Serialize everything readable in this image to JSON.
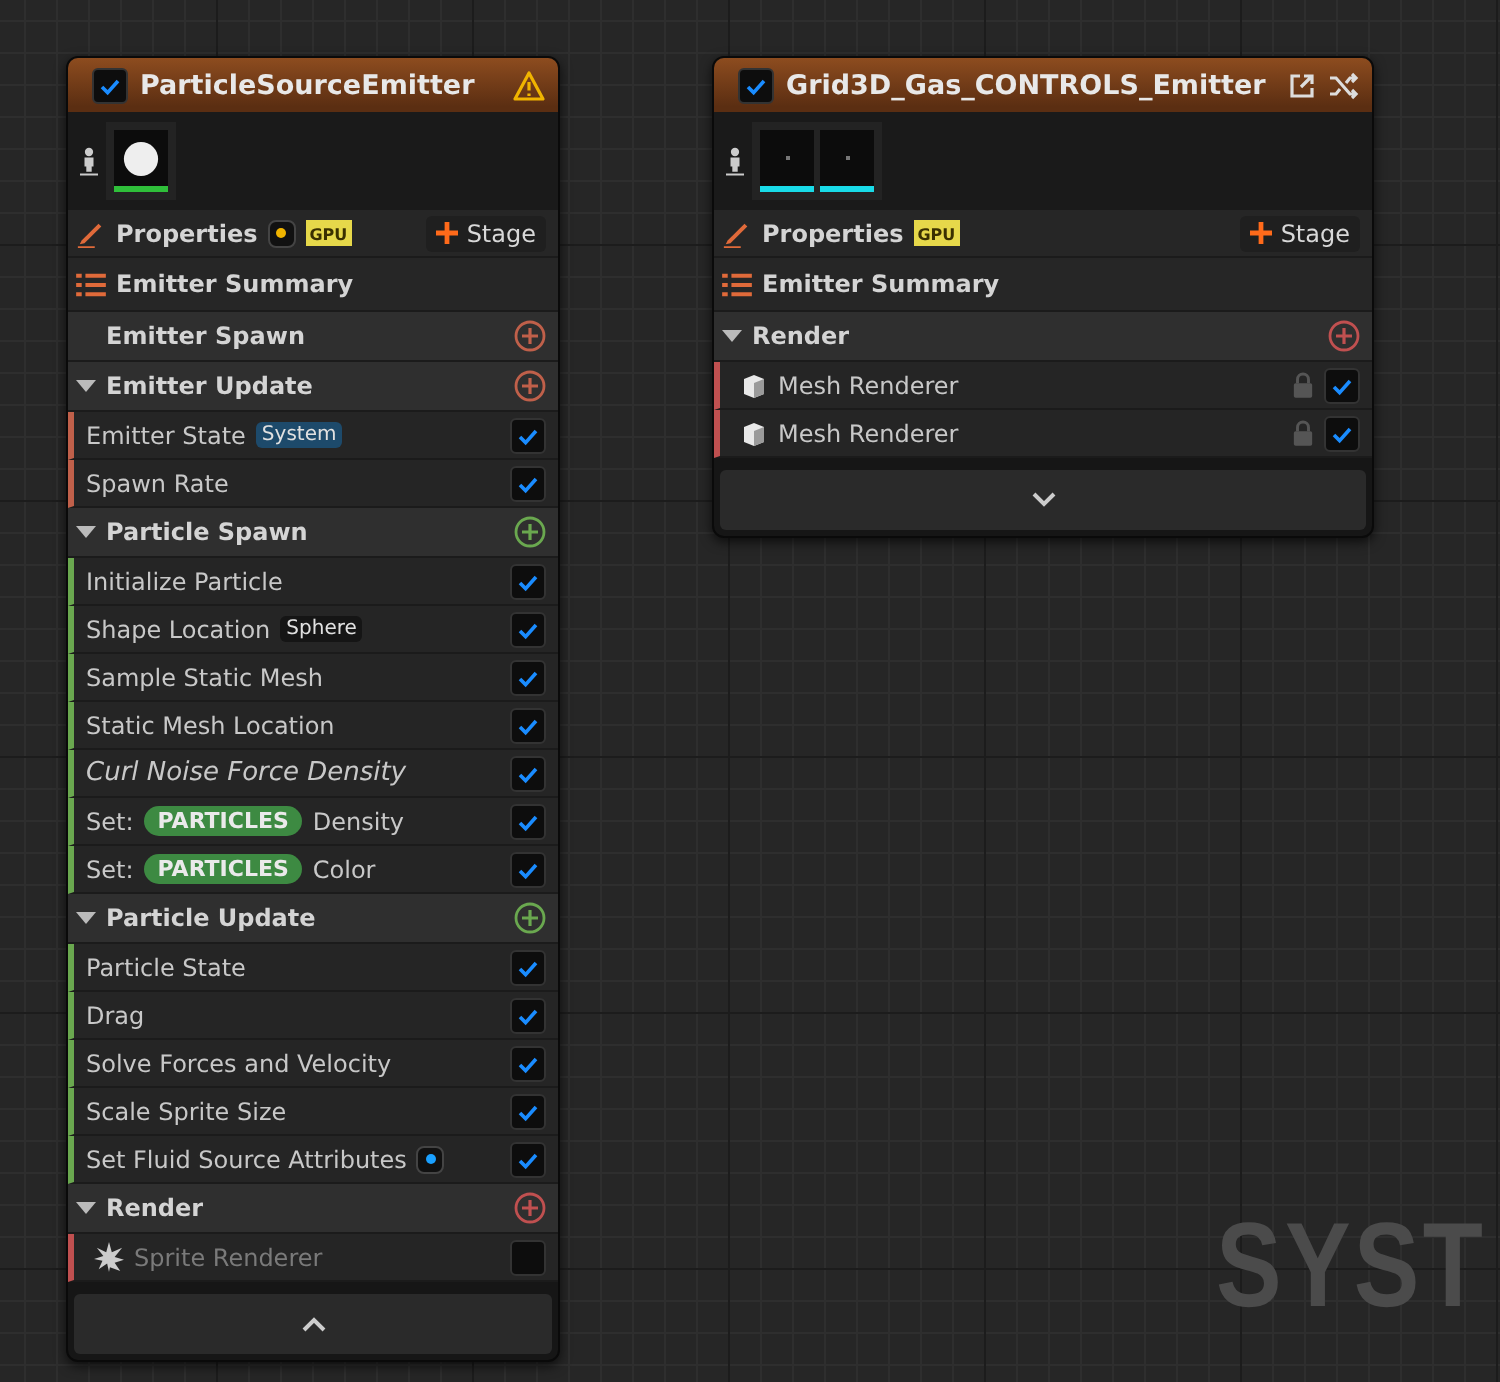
{
  "graph_label": "SYST",
  "emitters": [
    {
      "title": "ParticleSourceEmitter",
      "enabled": true,
      "header_icons": [
        {
          "kind": "warning"
        }
      ],
      "thumbnails": [
        {
          "kind": "sphere",
          "color": "#2fbf3a"
        }
      ],
      "properties": {
        "label": "Properties",
        "badges": [
          {
            "kind": "dot"
          },
          {
            "kind": "gpu",
            "text": "GPU"
          }
        ],
        "stage_button": "Stage"
      },
      "summary": "Emitter Summary",
      "sections": [
        {
          "title": "Emitter Spawn",
          "color": "#c0604a"
        },
        {
          "title": "Emitter Update",
          "color": "#c0604a",
          "modules": [
            {
              "kind": "module",
              "label": "Emitter State",
              "tag": {
                "text": "System",
                "color": "#1d4a6b"
              },
              "enabled": true
            },
            {
              "kind": "module",
              "label": "Spawn Rate",
              "enabled": true
            }
          ]
        },
        {
          "title": "Particle Spawn",
          "color": "#6aa84f",
          "modules": [
            {
              "kind": "module",
              "label": "Initialize Particle",
              "enabled": true
            },
            {
              "kind": "module",
              "label": "Shape Location",
              "tag": {
                "text": "Sphere",
                "color": "#151515"
              },
              "enabled": true
            },
            {
              "kind": "module",
              "label": "Sample Static Mesh",
              "enabled": true
            },
            {
              "kind": "module",
              "label": "Static Mesh Location",
              "enabled": true
            },
            {
              "kind": "dynamic_input",
              "label": "Curl Noise Force Density",
              "enabled": true
            },
            {
              "kind": "set",
              "prefix": "Set:",
              "pill": "PARTICLES",
              "label": "Density",
              "enabled": true
            },
            {
              "kind": "set",
              "prefix": "Set:",
              "pill": "PARTICLES",
              "label": "Color",
              "enabled": true
            }
          ]
        },
        {
          "title": "Particle Update",
          "color": "#6aa84f",
          "modules": [
            {
              "kind": "module",
              "label": "Particle State",
              "enabled": true
            },
            {
              "kind": "module",
              "label": "Drag",
              "enabled": true
            },
            {
              "kind": "module",
              "label": "Solve Forces and Velocity",
              "enabled": true
            },
            {
              "kind": "module",
              "label": "Scale Sprite Size",
              "enabled": true
            },
            {
              "kind": "event_module",
              "label": "Set Fluid Source Attributes",
              "enabled": true
            }
          ]
        },
        {
          "title": "Render",
          "color": "#c05050",
          "modules": [
            {
              "kind": "sprite_renderer",
              "label": "Sprite Renderer",
              "enabled": false
            }
          ]
        }
      ],
      "expanded": true
    },
    {
      "title": "Grid3D_Gas_CONTROLS_Emitter",
      "enabled": true,
      "header_icons": [
        {
          "kind": "open_external"
        },
        {
          "kind": "shuffle"
        }
      ],
      "thumbnails": [
        {
          "kind": "dark",
          "color": "#19dbe8"
        },
        {
          "kind": "dark",
          "color": "#19dbe8"
        }
      ],
      "properties": {
        "label": "Properties",
        "badges": [
          {
            "kind": "gpu",
            "text": "GPU"
          }
        ],
        "stage_button": "Stage"
      },
      "summary": "Emitter Summary",
      "sections": [
        {
          "title": "Render",
          "color": "#c05050",
          "modules": [
            {
              "kind": "mesh_renderer",
              "label": "Mesh Renderer",
              "enabled": true
            },
            {
              "kind": "mesh_renderer",
              "label": "Mesh Renderer",
              "enabled": true
            }
          ]
        }
      ],
      "expanded": false
    }
  ]
}
